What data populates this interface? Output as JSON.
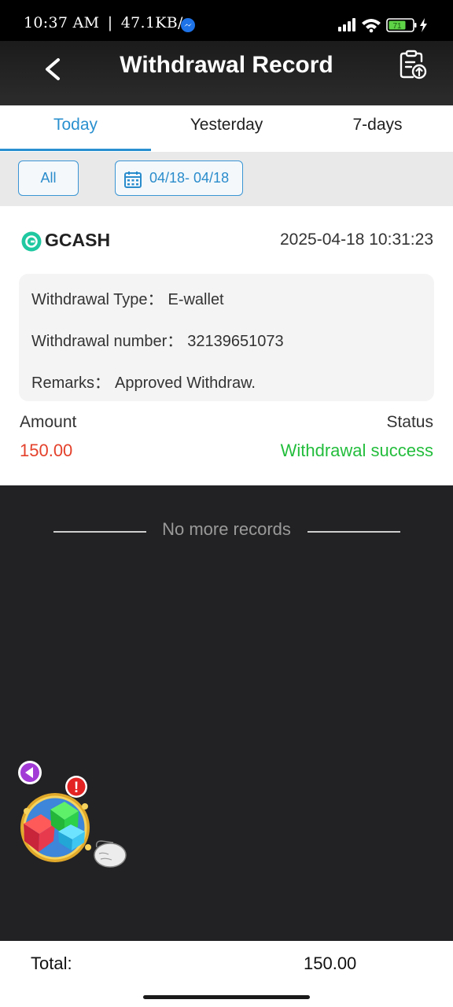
{
  "status_bar": {
    "time": "10:37 AM",
    "separator": "|",
    "speed": "47.1KB/s",
    "battery_level": "71",
    "icons": [
      "messenger-icon",
      "signal-icon",
      "wifi-icon",
      "battery-icon",
      "charging-icon"
    ]
  },
  "header": {
    "title": "Withdrawal Record",
    "back_icon": "chevron-left-icon",
    "action_icon": "clipboard-upload-icon"
  },
  "tabs": [
    {
      "label": "Today",
      "active": true
    },
    {
      "label": "Yesterday",
      "active": false
    },
    {
      "label": "7-days",
      "active": false
    }
  ],
  "filters": {
    "all_label": "All",
    "date_range": "04/18- 04/18",
    "date_icon": "calendar-icon"
  },
  "records": [
    {
      "method": "GCASH",
      "datetime": "2025-04-18 10:31:23",
      "details": [
        {
          "label": "Withdrawal Type：",
          "value": "E-wallet"
        },
        {
          "label": "Withdrawal number：",
          "value": "32139651073"
        },
        {
          "label": "Remarks：",
          "value": "Approved Withdraw."
        }
      ],
      "amount_label": "Amount",
      "amount": "150.00",
      "status_label": "Status",
      "status": "Withdrawal success"
    }
  ],
  "colors": {
    "accent": "#2a90cf",
    "amount": "#e4412b",
    "success": "#23bd3c",
    "gcash": "#1fc8a0"
  },
  "no_more_text": "No more records",
  "floating_widget": {
    "icon": "game-cube-icon",
    "badge_text": "!"
  },
  "footer": {
    "total_label": "Total:",
    "total_value": "150.00"
  }
}
